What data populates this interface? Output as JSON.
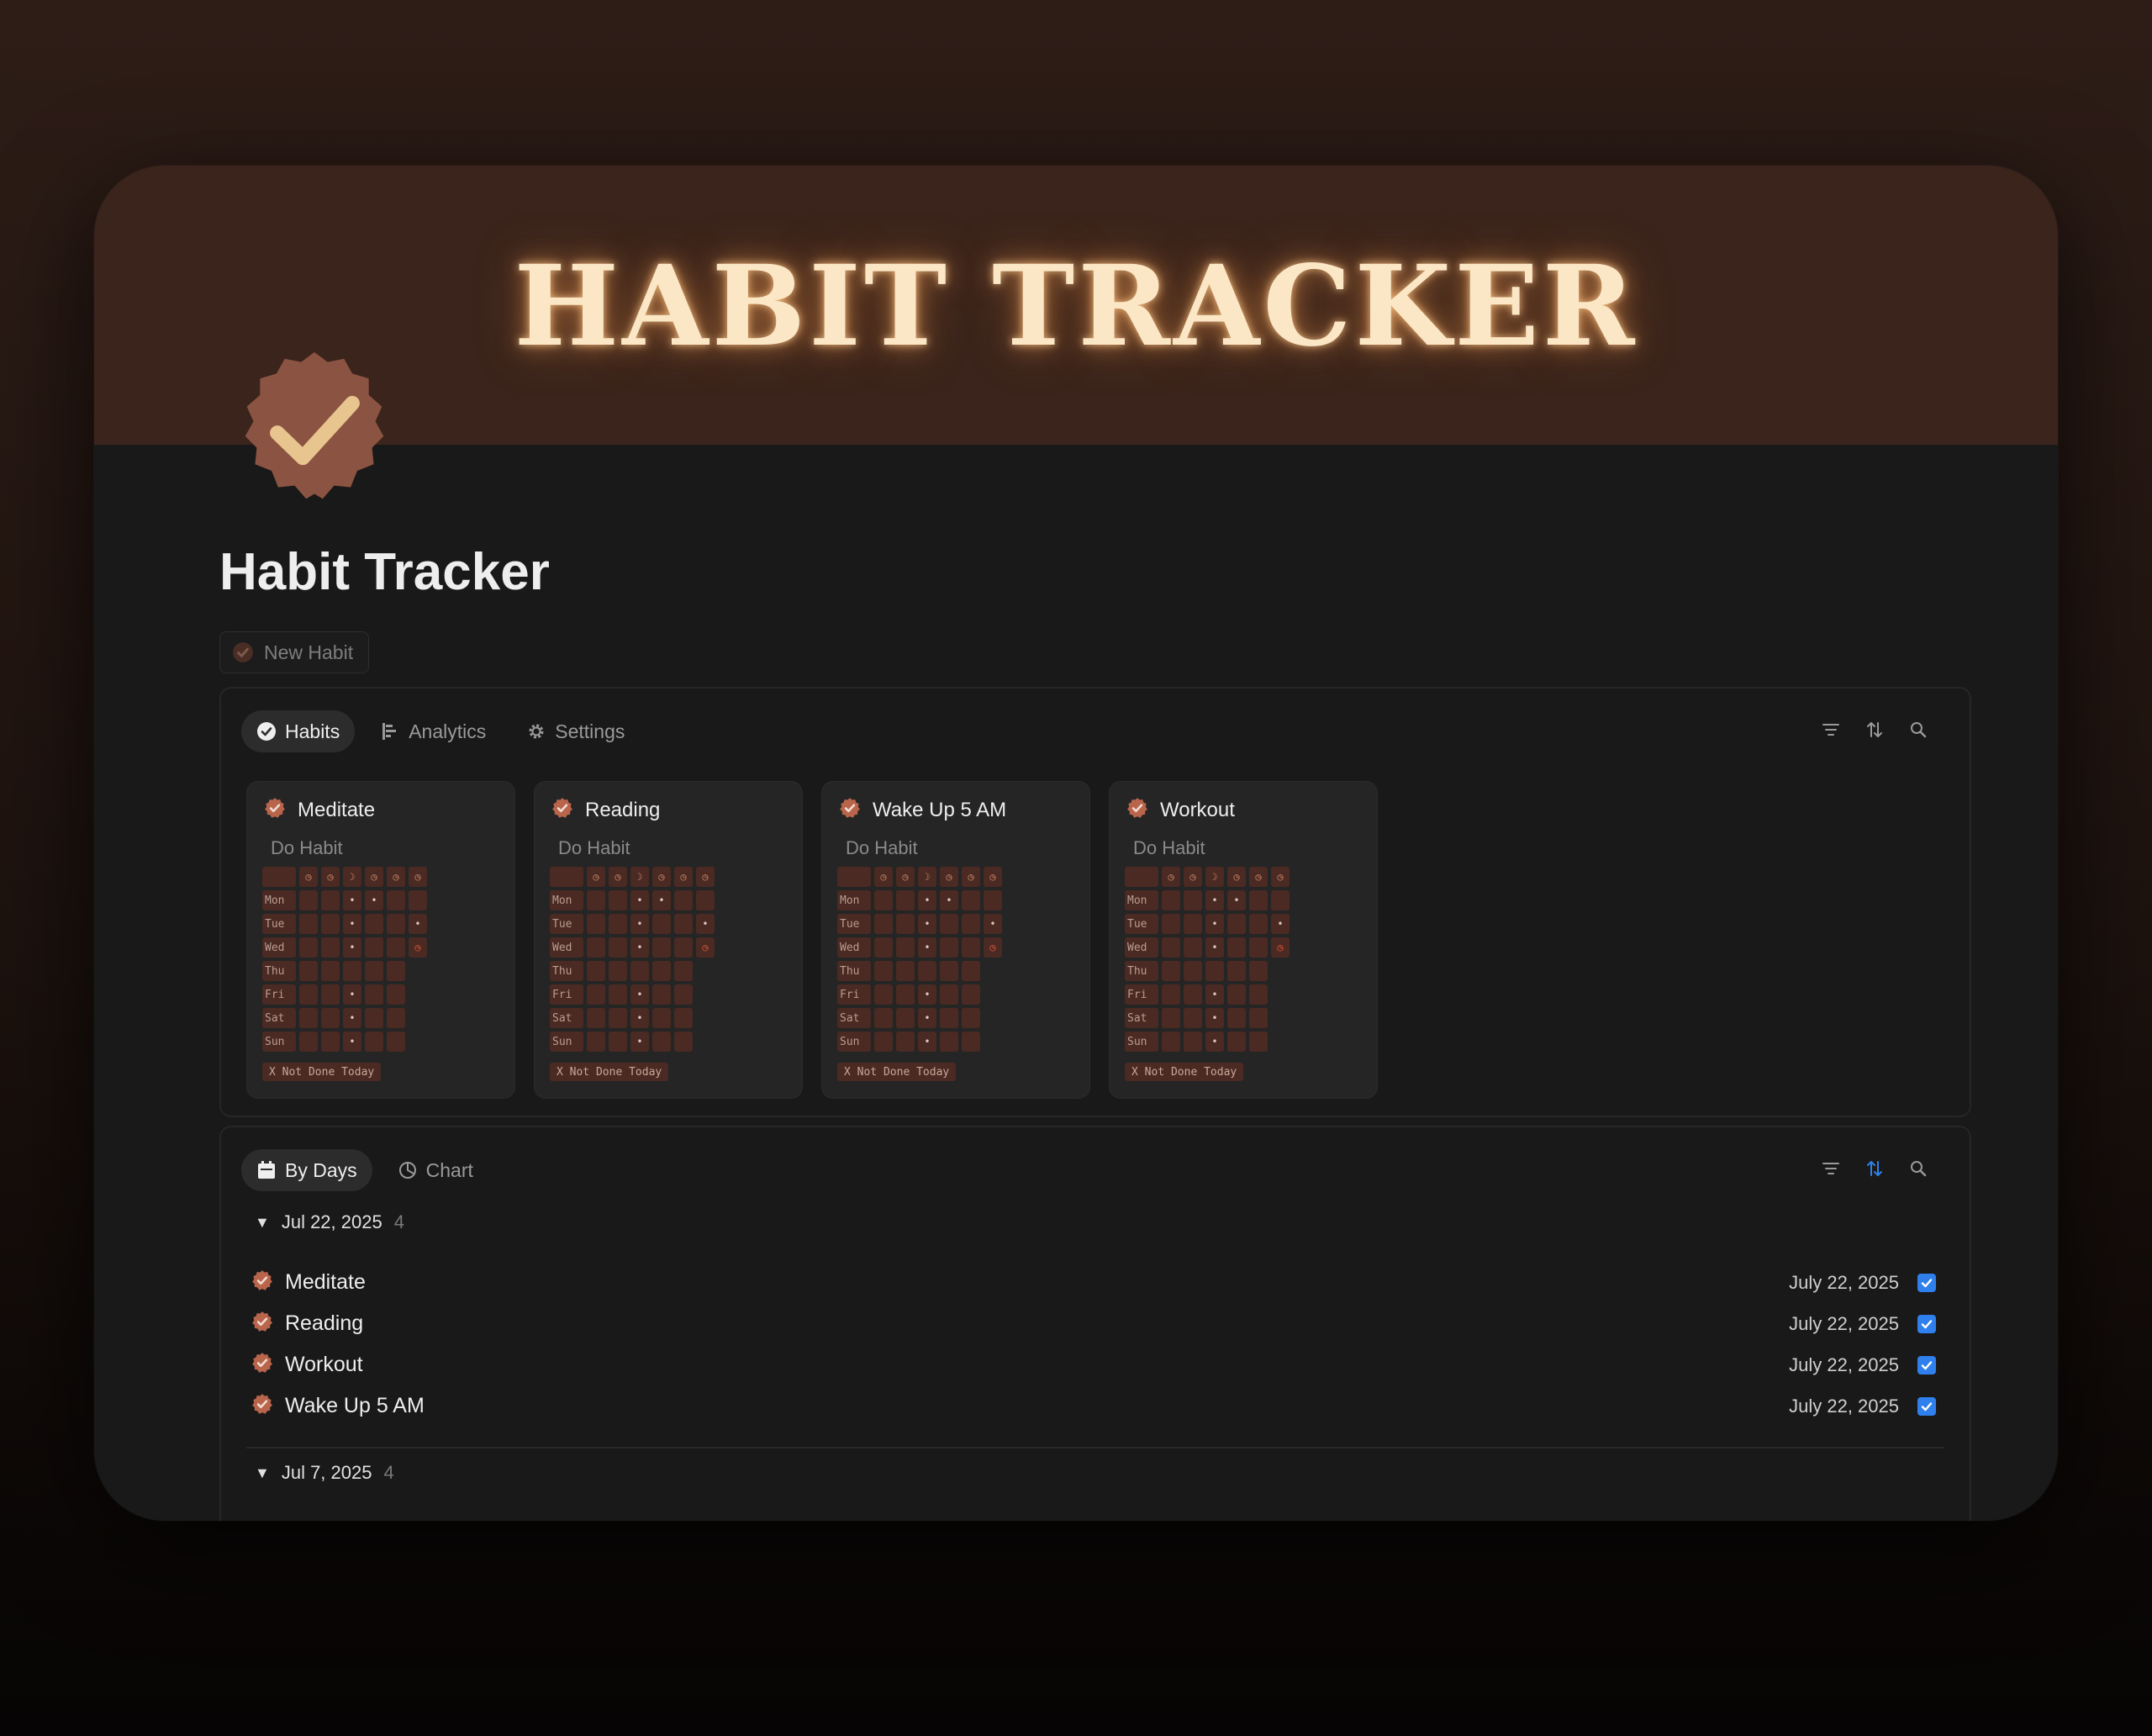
{
  "cover": {
    "title": "HABIT TRACKER"
  },
  "page": {
    "title": "Habit Tracker",
    "new_button": "New Habit"
  },
  "habits_view": {
    "tabs": [
      {
        "label": "Habits",
        "icon": "check-badge-icon",
        "active": true
      },
      {
        "label": "Analytics",
        "icon": "bar-chart-icon",
        "active": false
      },
      {
        "label": "Settings",
        "icon": "gear-icon",
        "active": false
      }
    ],
    "tools": [
      "filter-icon",
      "sort-icon",
      "search-icon"
    ],
    "cards": [
      {
        "title": "Meditate",
        "do_label": "Do Habit",
        "status": "X Not Done Today"
      },
      {
        "title": "Reading",
        "do_label": "Do Habit",
        "status": "X Not Done Today"
      },
      {
        "title": "Wake Up 5 AM",
        "do_label": "Do Habit",
        "status": "X Not Done Today"
      },
      {
        "title": "Workout",
        "do_label": "Do Habit",
        "status": "X Not Done Today"
      }
    ],
    "grid_days": [
      "Mon",
      "Tue",
      "Wed",
      "Thu",
      "Fri",
      "Sat",
      "Sun"
    ]
  },
  "days_view": {
    "tabs": [
      {
        "label": "By Days",
        "icon": "calendar-icon",
        "active": true
      },
      {
        "label": "Chart",
        "icon": "pie-chart-icon",
        "active": false
      }
    ],
    "groups": [
      {
        "label": "Jul 22, 2025",
        "count": "4",
        "items": [
          {
            "name": "Meditate",
            "date": "July 22, 2025",
            "checked": true
          },
          {
            "name": "Reading",
            "date": "July 22, 2025",
            "checked": true
          },
          {
            "name": "Workout",
            "date": "July 22, 2025",
            "checked": true
          },
          {
            "name": "Wake Up 5 AM",
            "date": "July 22, 2025",
            "checked": true
          }
        ]
      },
      {
        "label": "Jul 7, 2025",
        "count": "4"
      }
    ]
  },
  "colors": {
    "accent_brown": "#b8654c",
    "checkbox_blue": "#2f80ed",
    "cover_bg": "#3a241b",
    "cover_text": "#fbe7c6",
    "badge_bg": "#8b5342",
    "check_gold": "#e8c48e"
  }
}
